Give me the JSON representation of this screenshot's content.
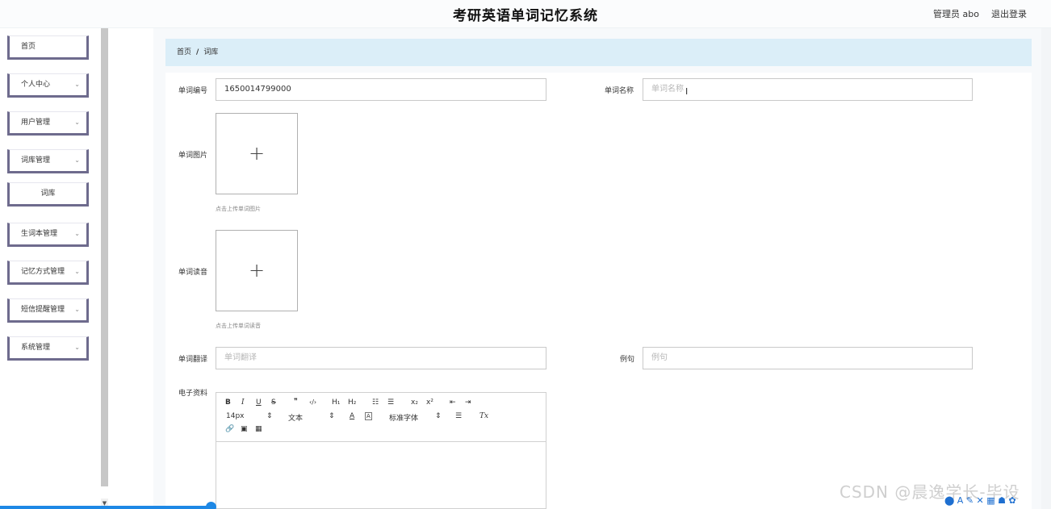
{
  "header": {
    "title": "考研英语单词记忆系统",
    "user": "管理员 abo",
    "logout": "退出登录"
  },
  "sidebar": {
    "items": [
      {
        "label": "首页",
        "chevron": ""
      },
      {
        "label": "个人中心",
        "chevron": "⌄"
      },
      {
        "label": "用户管理",
        "chevron": "⌄"
      },
      {
        "label": "词库管理",
        "chevron": "⌄"
      },
      {
        "label": "词库",
        "chevron": ""
      },
      {
        "label": "生词本管理",
        "chevron": "⌄"
      },
      {
        "label": "记忆方式管理",
        "chevron": "⌄"
      },
      {
        "label": "短信提醒管理",
        "chevron": "⌄"
      },
      {
        "label": "系统管理",
        "chevron": "⌄"
      }
    ]
  },
  "breadcrumb": {
    "home": "首页",
    "separator": "/",
    "current": "词库"
  },
  "form": {
    "word_number": {
      "label": "单词编号",
      "value": "1650014799000"
    },
    "word_name": {
      "label": "单词名称",
      "placeholder": "单词名称"
    },
    "word_image": {
      "label": "单词图片",
      "hint": "点击上传单词图片"
    },
    "word_audio": {
      "label": "单词读音",
      "hint": "点击上传单词读音"
    },
    "translation": {
      "label": "单词翻译",
      "placeholder": "单词翻译"
    },
    "example": {
      "label": "例句",
      "placeholder": "例句"
    },
    "ebook": {
      "label": "电子资料"
    }
  },
  "editor": {
    "row1": [
      "B",
      "I",
      "U",
      "S",
      "❞",
      "‹/›",
      "H₁",
      "H₂",
      "☷",
      "☰",
      "x₂",
      "x²",
      "⇤",
      "⇥"
    ],
    "font_size": "14px",
    "text_style": "文本",
    "font_family": "标准字体",
    "row3": [
      "🔗",
      "▣",
      "▦"
    ],
    "clear_format": "Tx"
  },
  "watermark": "CSDN @晨逸学长-毕设",
  "colors": {
    "accent": "#6e6b8d",
    "breadcrumb_bg": "#dbeef8",
    "highlight": "#1e88e5"
  }
}
